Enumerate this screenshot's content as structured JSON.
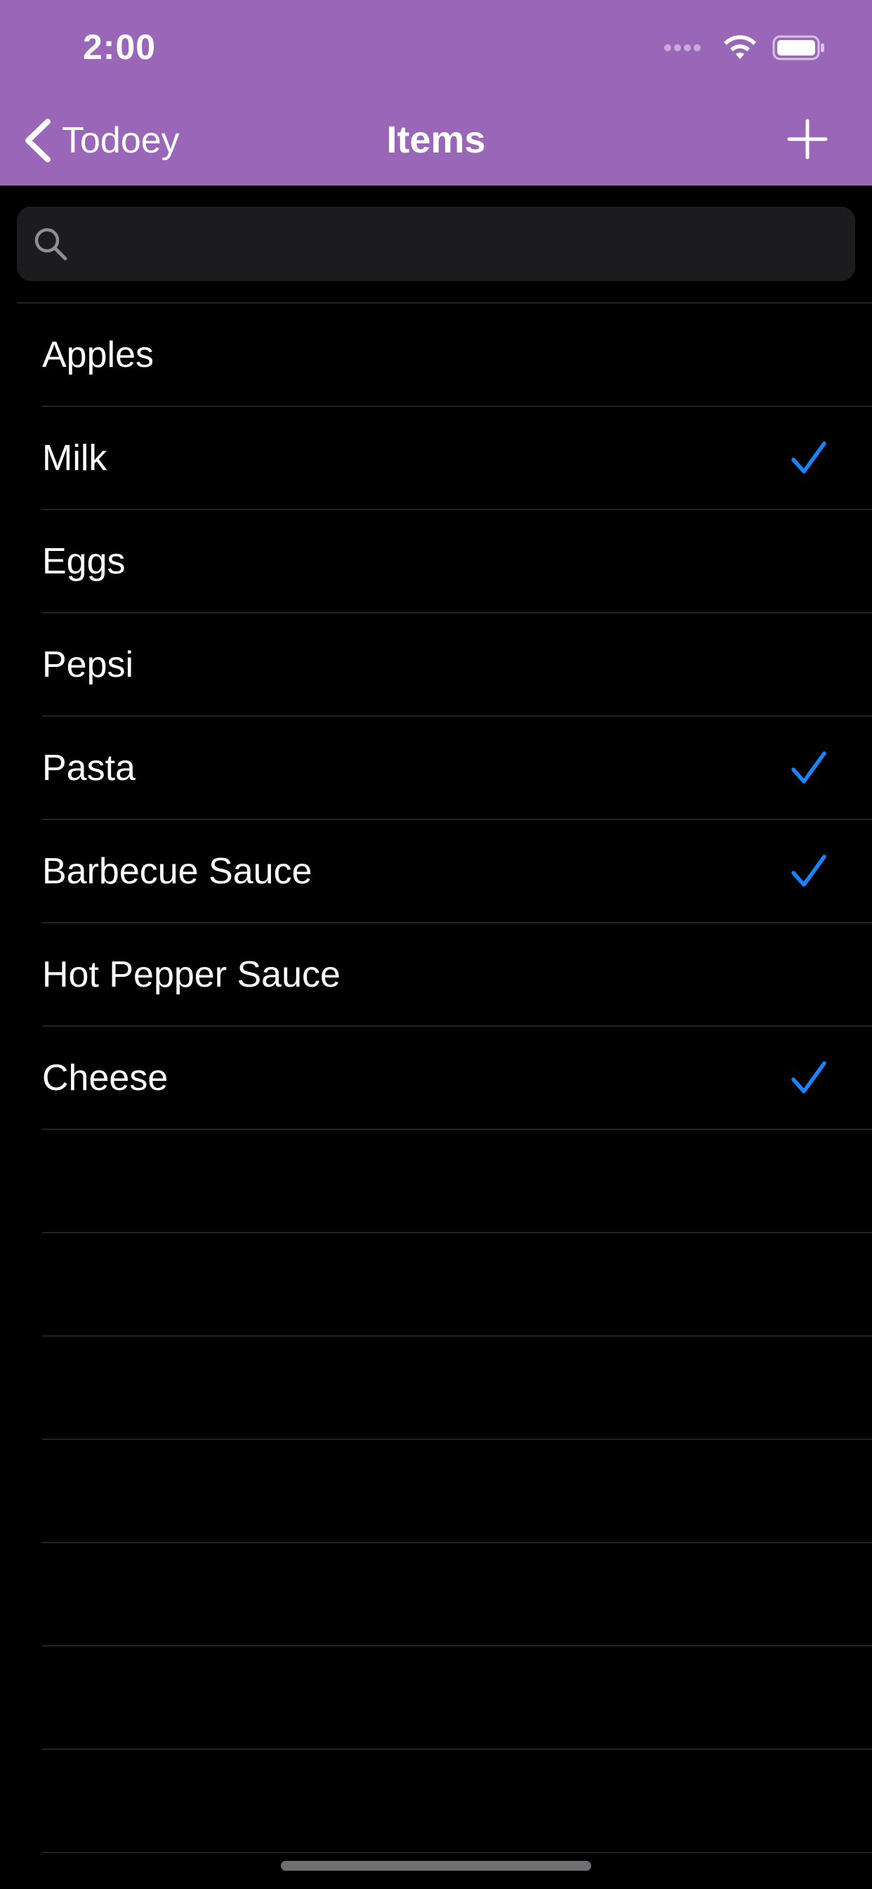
{
  "status_bar": {
    "time": "2:00",
    "wifi_icon": "wifi-icon",
    "battery_icon": "battery-icon"
  },
  "nav": {
    "back_label": "Todoey",
    "title": "Items",
    "add_icon": "plus-icon",
    "background_color": "#9966B8"
  },
  "search": {
    "placeholder": "",
    "value": ""
  },
  "items": [
    {
      "label": "Apples",
      "checked": false
    },
    {
      "label": "Milk",
      "checked": true
    },
    {
      "label": "Eggs",
      "checked": false
    },
    {
      "label": "Pepsi",
      "checked": false
    },
    {
      "label": "Pasta",
      "checked": true
    },
    {
      "label": "Barbecue Sauce",
      "checked": true
    },
    {
      "label": "Hot Pepper Sauce",
      "checked": false
    },
    {
      "label": "Cheese",
      "checked": true
    }
  ],
  "empty_row_count": 7,
  "colors": {
    "checkmark": "#1A84FF",
    "separator": "#222224"
  }
}
